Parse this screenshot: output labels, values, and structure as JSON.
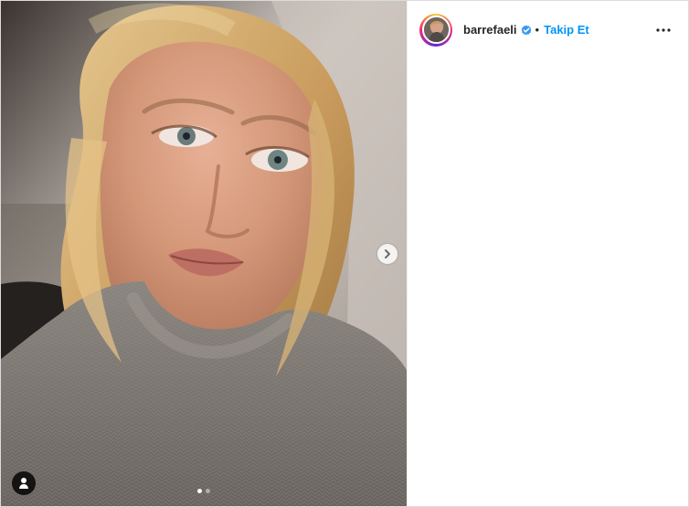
{
  "post": {
    "carousel": {
      "slide_count": 2,
      "active_slide": 1
    },
    "icons": {
      "next": "chevron-right-icon",
      "tagged_users": "user-tag-icon",
      "verified": "verified-badge-icon",
      "more": "more-horizontal-icon"
    }
  },
  "header": {
    "username": "barrefaeli",
    "separator": "•",
    "follow_label": "Takip Et"
  },
  "colors": {
    "follow_text": "#0095f6",
    "verified_badge": "#3897f0"
  }
}
